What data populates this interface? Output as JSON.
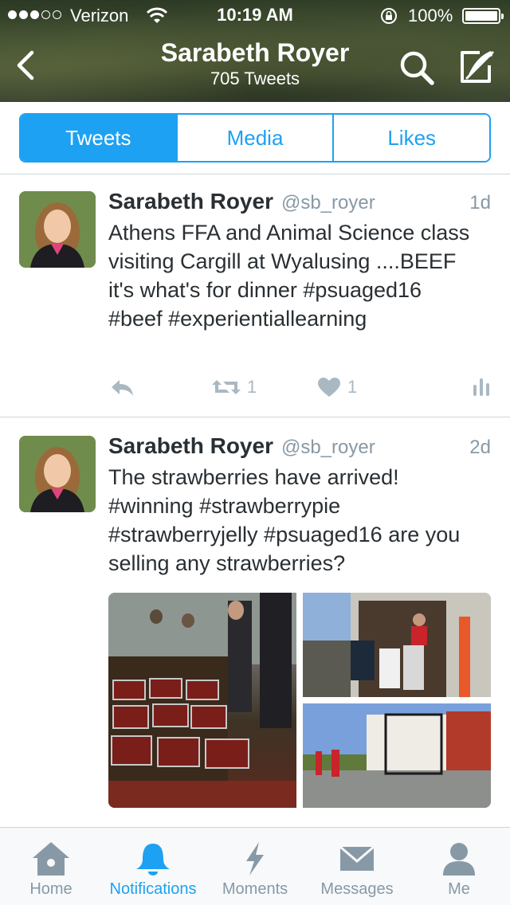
{
  "status_bar": {
    "carrier": "Verizon",
    "time": "10:19 AM",
    "battery": "100%",
    "signal_dots_filled": 3,
    "signal_dots_total": 5
  },
  "nav": {
    "title": "Sarabeth Royer",
    "subtitle": "705 Tweets",
    "back_icon": "chevron-left-icon",
    "search_icon": "search-icon",
    "compose_icon": "compose-icon"
  },
  "segments": [
    {
      "label": "Tweets",
      "active": true
    },
    {
      "label": "Media",
      "active": false
    },
    {
      "label": "Likes",
      "active": false
    }
  ],
  "tweets": [
    {
      "name": "Sarabeth Royer",
      "handle": "@sb_royer",
      "time": "1d",
      "text": "Athens FFA and Animal Science class visiting Cargill at Wyalusing ....BEEF it's what's for dinner #psuaged16 #beef #experientiallearning",
      "retweets": "1",
      "likes": "1"
    },
    {
      "name": "Sarabeth Royer",
      "handle": "@sb_royer",
      "time": "2d",
      "text": "The strawberries have arrived! #winning #strawberrypie #strawberryjelly #psuaged16 are you selling any strawberries?"
    }
  ],
  "tabbar": [
    {
      "label": "Home",
      "icon": "home-icon",
      "active": false
    },
    {
      "label": "Notifications",
      "icon": "bell-icon",
      "active": true
    },
    {
      "label": "Moments",
      "icon": "lightning-icon",
      "active": false
    },
    {
      "label": "Messages",
      "icon": "envelope-icon",
      "active": false
    },
    {
      "label": "Me",
      "icon": "person-icon",
      "active": false
    }
  ],
  "colors": {
    "accent": "#1da1f2",
    "text": "#292f33",
    "muted": "#8899a6",
    "icon_muted": "#aab8c2"
  }
}
